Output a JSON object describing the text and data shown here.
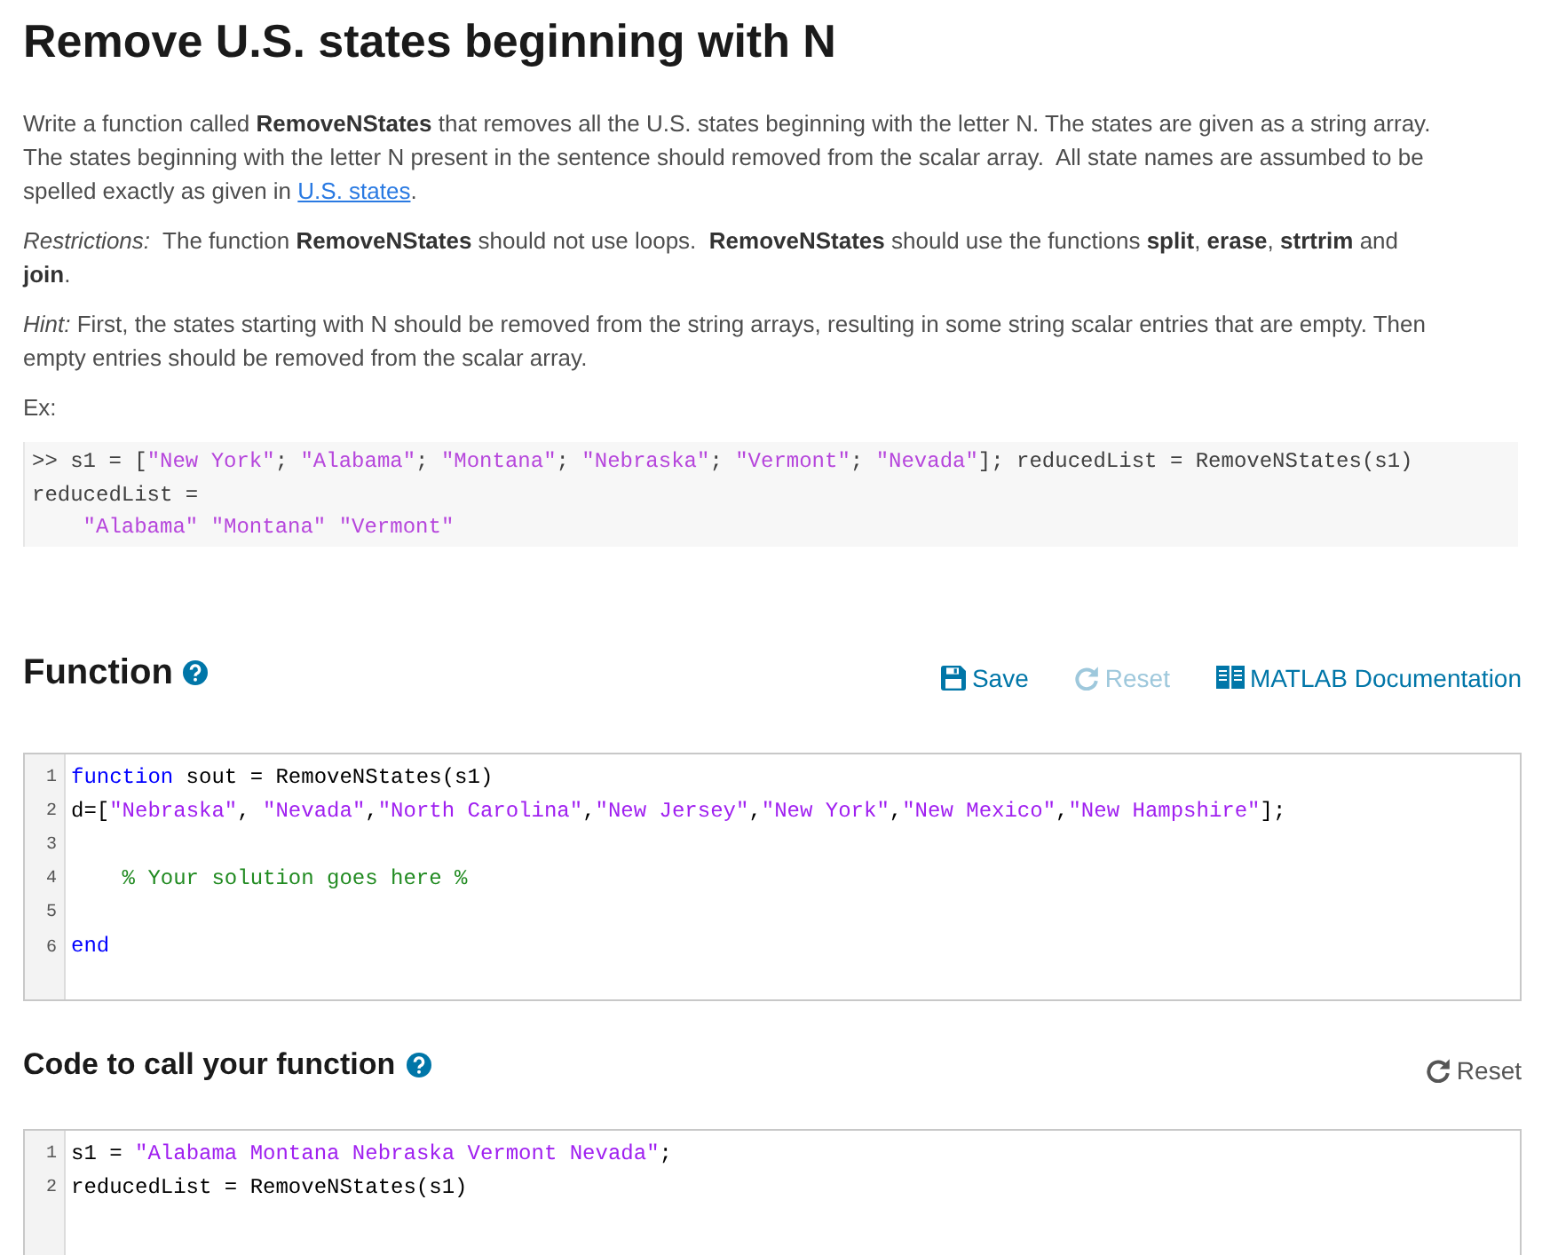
{
  "title": "Remove U.S. states beginning with N",
  "description": [
    {
      "text": "Write a function called **RemoveNStates** that removes all the U.S. states beginning with the letter N. The states are given as a string array. The states beginning with the letter N present in the sentence should removed from the scalar array.  All state names are assumbed to be spelled exactly as given in ",
      "link": "U.S. states",
      "after": "."
    },
    {
      "text": "*Restrictions:*  The function **RemoveNStates** should not use loops.  **RemoveNStates** should use the functions **split**, **erase**, **strtrim** and **join**."
    },
    {
      "text": "*Hint:* First, the states starting with N should be removed from the string arrays, resulting in some string scalar entries that are empty. Then empty entries should be removed from the scalar array."
    }
  ],
  "example_label": "Ex:",
  "example": {
    "lines": [
      [
        {
          "kind": "plain",
          "text": ">> s1 = ["
        },
        {
          "kind": "string",
          "text": "\"New York\""
        },
        {
          "kind": "plain",
          "text": "; "
        },
        {
          "kind": "string",
          "text": "\"Alabama\""
        },
        {
          "kind": "plain",
          "text": "; "
        },
        {
          "kind": "string",
          "text": "\"Montana\""
        },
        {
          "kind": "plain",
          "text": "; "
        },
        {
          "kind": "string",
          "text": "\"Nebraska\""
        },
        {
          "kind": "plain",
          "text": "; "
        },
        {
          "kind": "string",
          "text": "\"Vermont\""
        },
        {
          "kind": "plain",
          "text": "; "
        },
        {
          "kind": "string",
          "text": "\"Nevada\""
        },
        {
          "kind": "plain",
          "text": "]; reducedList = RemoveNStates(s1)"
        }
      ],
      [
        {
          "kind": "plain",
          "text": "reducedList ="
        }
      ],
      [
        {
          "kind": "string",
          "text": "    \"Alabama\" \"Montana\" \"Vermont\""
        }
      ]
    ]
  },
  "function_section": {
    "heading": "Function",
    "buttons": [
      {
        "kind": "save",
        "label": "Save",
        "disabled": false
      },
      {
        "kind": "reset",
        "label": "Reset",
        "disabled": true
      },
      {
        "kind": "docs",
        "label": "MATLAB Documentation",
        "disabled": false
      }
    ],
    "editor": {
      "lines": [
        {
          "number": "1",
          "tokens": [
            {
              "kind": "keyword",
              "text": "function"
            },
            {
              "kind": "plain",
              "text": " sout = RemoveNStates(s1)"
            }
          ]
        },
        {
          "number": "2",
          "tokens": [
            {
              "kind": "plain",
              "text": "d=["
            },
            {
              "kind": "string",
              "text": "\"Nebraska\""
            },
            {
              "kind": "plain",
              "text": ", "
            },
            {
              "kind": "string",
              "text": "\"Nevada\""
            },
            {
              "kind": "plain",
              "text": ","
            },
            {
              "kind": "string",
              "text": "\"North Carolina\""
            },
            {
              "kind": "plain",
              "text": ","
            },
            {
              "kind": "string",
              "text": "\"New Jersey\""
            },
            {
              "kind": "plain",
              "text": ","
            },
            {
              "kind": "string",
              "text": "\"New York\""
            },
            {
              "kind": "plain",
              "text": ","
            },
            {
              "kind": "string",
              "text": "\"New Mexico\""
            },
            {
              "kind": "plain",
              "text": ","
            },
            {
              "kind": "string",
              "text": "\"New Hampshire\""
            },
            {
              "kind": "plain",
              "text": "];"
            }
          ]
        },
        {
          "number": "3"
        },
        {
          "number": "4",
          "tokens": [
            {
              "kind": "comment",
              "text": "    % Your solution goes here %"
            }
          ]
        },
        {
          "number": "5"
        },
        {
          "number": "6",
          "tokens": [
            {
              "kind": "keyword",
              "text": "end"
            }
          ]
        }
      ]
    }
  },
  "call_section": {
    "heading": "Code to call your function",
    "buttons": [
      {
        "kind": "reset",
        "label": "Reset",
        "disabled": false
      }
    ],
    "editor": {
      "lines": [
        {
          "number": "1",
          "tokens": [
            {
              "kind": "plain",
              "text": "s1 = "
            },
            {
              "kind": "string",
              "text": "\"Alabama Montana Nebraska Vermont Nevada\""
            },
            {
              "kind": "plain",
              "text": ";"
            }
          ]
        },
        {
          "number": "2",
          "tokens": [
            {
              "kind": "plain",
              "text": "reducedList = RemoveNStates(s1)"
            }
          ]
        }
      ]
    }
  }
}
